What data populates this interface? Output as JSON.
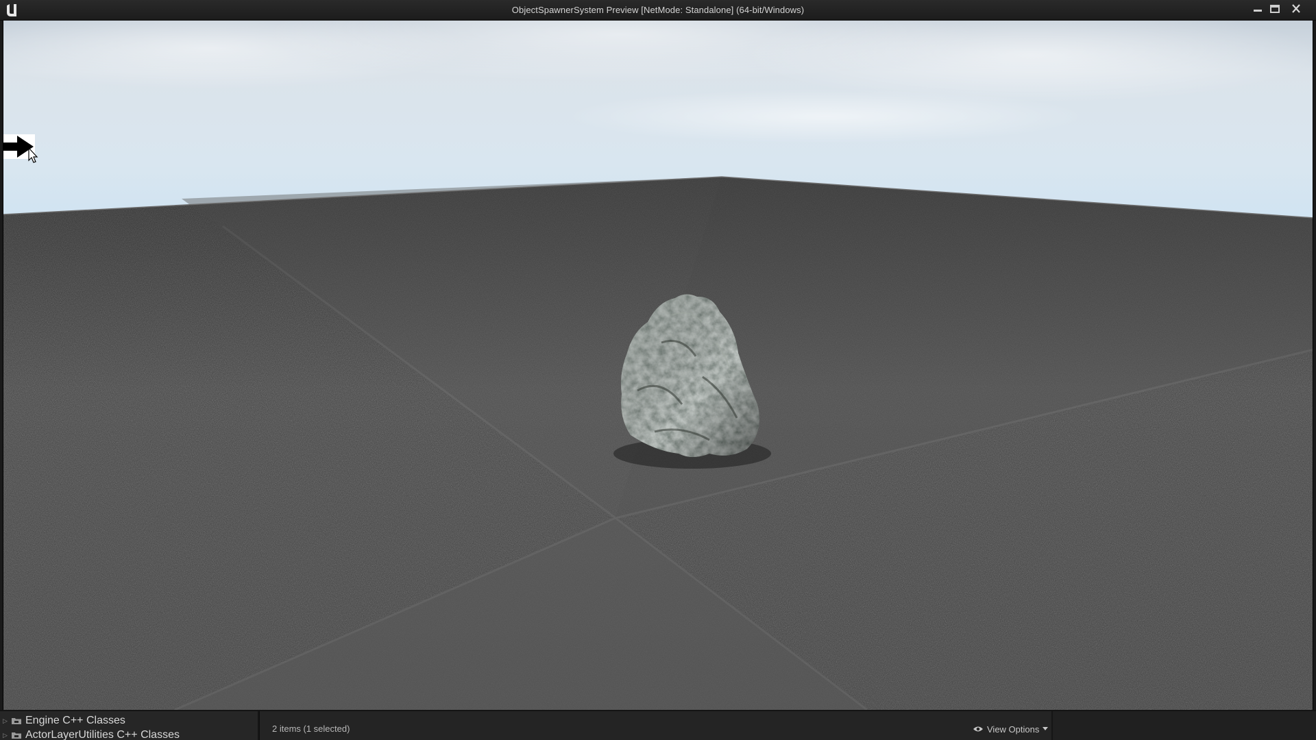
{
  "window": {
    "title": "ObjectSpawnerSystem Preview [NetMode: Standalone]  (64-bit/Windows)",
    "logo": "unreal-engine-logo",
    "controls": [
      "minimize-icon",
      "maximize-icon",
      "close-icon"
    ]
  },
  "viewport": {
    "scene": "rock-on-floor",
    "cursor": "hand-pointer-arrow-cursor"
  },
  "content_browser": {
    "folders": [
      {
        "label": "Engine C++ Classes",
        "icon": "folder-icon"
      },
      {
        "label": "ActorLayerUtilities C++ Classes",
        "icon": "folder-icon"
      }
    ],
    "status": "2 items (1 selected)",
    "view_options": {
      "label": "View Options",
      "icon": "eye-icon"
    }
  }
}
